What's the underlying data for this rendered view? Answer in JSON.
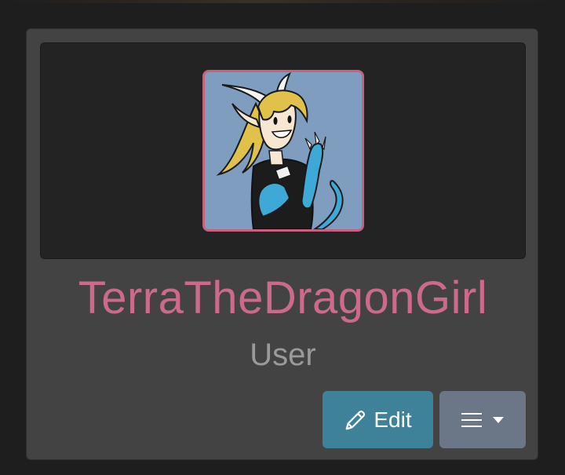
{
  "profile": {
    "username": "TerraTheDragonGirl",
    "role": "User",
    "avatar_alt": "avatar"
  },
  "actions": {
    "edit_label": "Edit",
    "edit_icon": "pencil-icon",
    "menu_icon": "bars-icon",
    "menu_caret_icon": "caret-down-icon"
  },
  "colors": {
    "username": "#cc6a8c",
    "avatar_border": "#c8607f",
    "edit_button": "#3d8299",
    "menu_button": "#6b7686",
    "card_bg": "#434343",
    "banner_bg": "#232323"
  }
}
